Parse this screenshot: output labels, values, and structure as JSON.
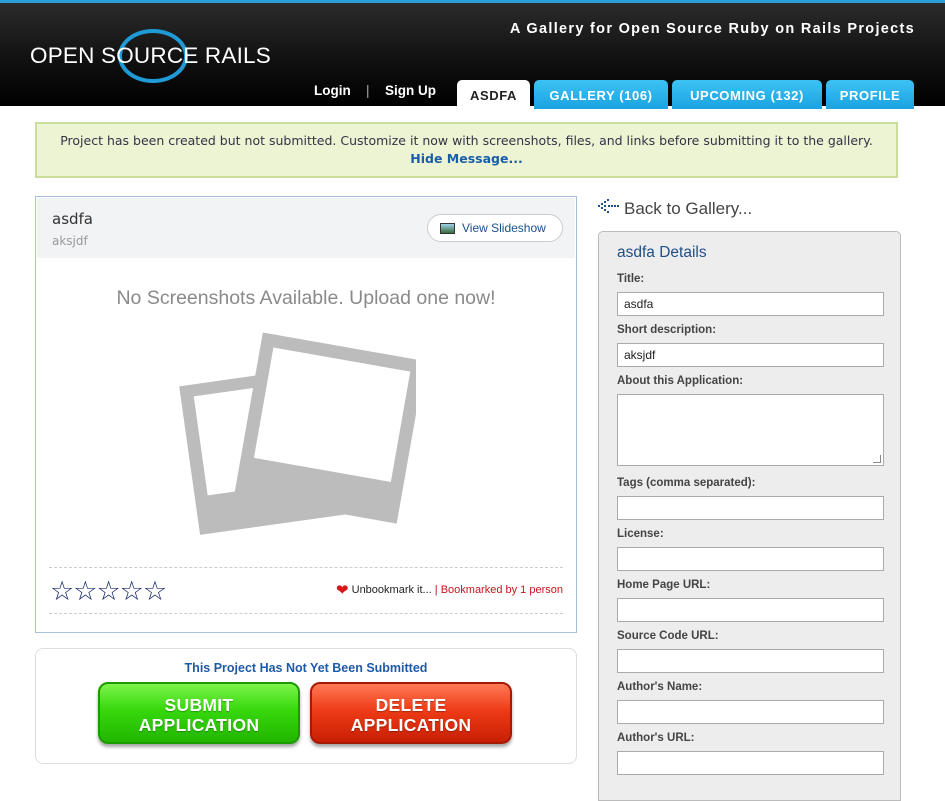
{
  "header": {
    "logo_text": "OPEN SOURCE RAILS",
    "tagline": "A Gallery for Open Source Ruby on Rails Projects",
    "login": "Login",
    "separator": "|",
    "signup": "Sign Up",
    "tabs": [
      {
        "label": "ASDFA",
        "active": true
      },
      {
        "label": "GALLERY (106)",
        "active": false
      },
      {
        "label": "UPCOMING (132)",
        "active": false
      },
      {
        "label": "PROFILE",
        "active": false
      }
    ]
  },
  "notice": {
    "text": "Project has been created but not submitted. Customize it now with screenshots, files, and links before submitting it to the gallery.",
    "hide_link": "Hide Message..."
  },
  "project": {
    "title": "asdfa",
    "subtitle": "aksjdf",
    "slideshow_label": "View Slideshow",
    "no_screenshots": "No Screenshots Available. Upload one now!",
    "rating_stars": 5,
    "rating_value": 0,
    "unbookmark": "Unbookmark it...",
    "pipe": "|",
    "bookmarked_by": "Bookmarked by 1 person"
  },
  "submit_box": {
    "title": "This Project Has Not Yet Been Submitted",
    "submit_line1": "SUBMIT",
    "submit_line2": "APPLICATION",
    "delete_line1": "DELETE",
    "delete_line2": "APPLICATION"
  },
  "sidebar": {
    "back_label": "Back to Gallery...",
    "details_title": "asdfa Details",
    "fields": [
      {
        "label": "Title:",
        "value": "asdfa"
      },
      {
        "label": "Short description:",
        "value": "aksjdf"
      },
      {
        "label": "About this Application:",
        "value": ""
      },
      {
        "label": "Tags (comma separated):",
        "value": ""
      },
      {
        "label": "License:",
        "value": ""
      },
      {
        "label": "Home Page URL:",
        "value": ""
      },
      {
        "label": "Source Code URL:",
        "value": ""
      },
      {
        "label": "Author's Name:",
        "value": ""
      },
      {
        "label": "Author's URL:",
        "value": ""
      }
    ]
  },
  "colors": {
    "accent_blue": "#1aa3e2",
    "notice_bg": "#ecf4d4",
    "submit_green": "#37d80d",
    "delete_red": "#ee3b17"
  },
  "icons": [
    "back-arrow-icon",
    "slideshow-icon",
    "heart-icon",
    "star-icon",
    "photo-placeholder-icon"
  ]
}
